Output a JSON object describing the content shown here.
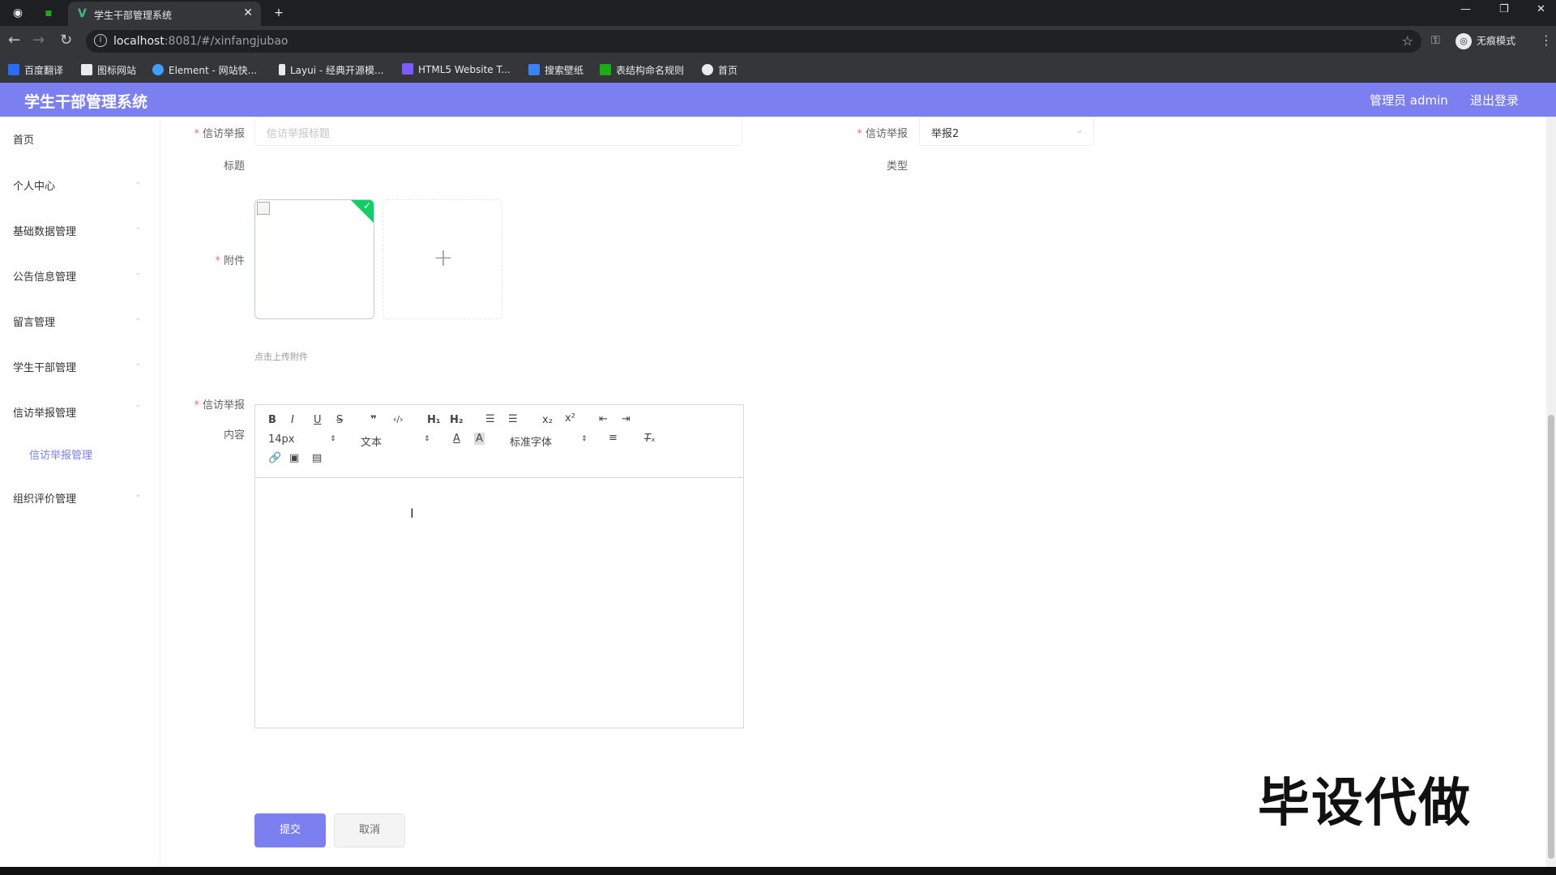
{
  "browser": {
    "tab_title": "学生干部管理系统",
    "url_host": "localhost",
    "url_rest": ":8081/#/xinfangjubao",
    "incognito_label": "无痕模式",
    "bookmarks": [
      {
        "label": "百度翻译",
        "color": "#2b6cf6"
      },
      {
        "label": "图标网站",
        "color": "#e8eaed"
      },
      {
        "label": "Element - 网站快...",
        "color": "#409eff"
      },
      {
        "label": "Layui - 经典开源模...",
        "color": "#e8eaed"
      },
      {
        "label": "HTML5 Website T...",
        "color": "#7a5cff"
      },
      {
        "label": "搜索壁纸",
        "color": "#3b82f6"
      },
      {
        "label": "表结构命名规则",
        "color": "#1aad19"
      },
      {
        "label": "首页",
        "color": "#e8eaed"
      }
    ]
  },
  "app": {
    "title": "学生干部管理系统",
    "user": "管理员 admin",
    "logout": "退出登录",
    "accent_color": "#7b7ff0"
  },
  "sidebar": {
    "items": [
      {
        "label": "首页"
      },
      {
        "label": "个人中心"
      },
      {
        "label": "基础数据管理"
      },
      {
        "label": "公告信息管理"
      },
      {
        "label": "留言管理"
      },
      {
        "label": "学生干部管理"
      },
      {
        "label": "信访举报管理"
      },
      {
        "label": "组织评价管理"
      }
    ],
    "active_sub": "信访举报管理"
  },
  "form": {
    "title_label_1": "信访举报",
    "title_label_2": "标题",
    "title_placeholder": "信访举报标题",
    "type_label_1": "信访举报",
    "type_label_2": "类型",
    "type_value": "举报2",
    "attachment_label": "附件",
    "upload_hint": "点击上传附件",
    "content_label_1": "信访举报",
    "content_label_2": "内容",
    "editor": {
      "font_size": "14px",
      "block_format": "文本",
      "font_family": "标准字体"
    },
    "submit": "提交",
    "cancel": "取消"
  },
  "watermark": "毕设代做"
}
